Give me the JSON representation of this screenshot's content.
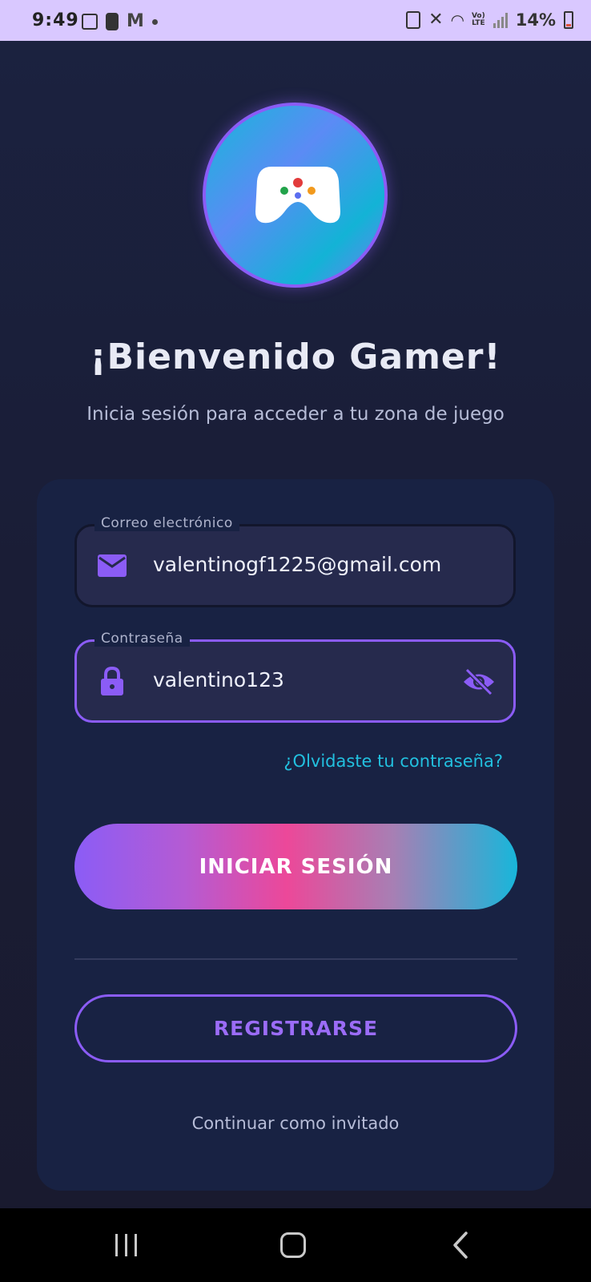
{
  "status_bar": {
    "time": "9:49",
    "battery_text": "14%",
    "network": "LTE"
  },
  "welcome": {
    "title": "¡Bienvenido Gamer!",
    "subtitle": "Inicia sesión para acceder a tu zona de juego"
  },
  "form": {
    "email": {
      "label": "Correo electrónico",
      "value": "valentinogf1225@gmail.com"
    },
    "password": {
      "label": "Contraseña",
      "value": "valentino123"
    },
    "forgot_label": "¿Olvidaste tu contraseña?",
    "login_label": "INICIAR SESIÓN",
    "register_label": "REGISTRARSE",
    "guest_label": "Continuar como invitado"
  },
  "colors": {
    "accent": "#8b5cf6",
    "link": "#22c0df",
    "pink": "#ec4899",
    "cyan": "#18b6da"
  },
  "icons": {
    "logo": "gamepad-icon",
    "email": "mail-icon",
    "password": "lock-icon",
    "visibility": "eye-off-icon"
  }
}
